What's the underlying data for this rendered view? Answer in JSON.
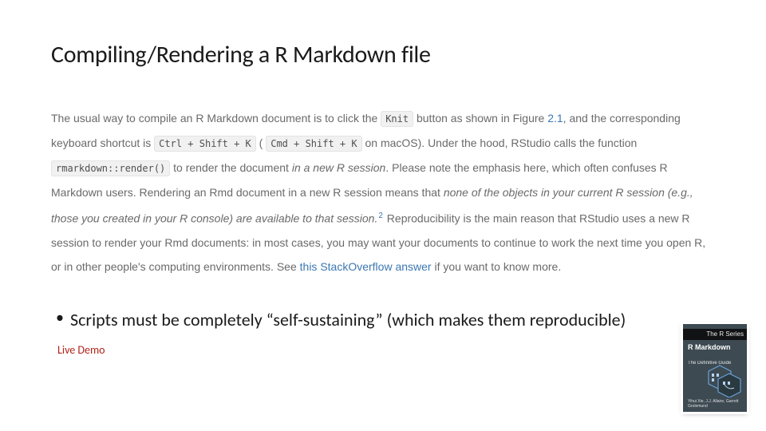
{
  "title": "Compiling/Rendering a R Markdown file",
  "excerpt": {
    "pre_knit": "The usual way to compile an R Markdown document is to click the ",
    "knit_code": "Knit",
    "post_knit": " button as shown in Figure ",
    "fig_ref": "2.1",
    "after_fig": ", and the corresponding keyboard shortcut is ",
    "kbd1": "Ctrl + Shift + K",
    "paren_open": " (",
    "kbd2": "Cmd + Shift + K",
    "paren_close": " on macOS). Under the hood, RStudio calls the function ",
    "render_code": "rmarkdown::render()",
    "after_render": " to render the document ",
    "em1": "in a new R session",
    "after_em1": ". Please note the emphasis here, which often confuses R Markdown users. Rendering an Rmd document in a new R session means that ",
    "em2": "none of the objects in your current R session (e.g., those you created in your R console) are available to that session.",
    "sup": "2",
    "after_sup": " Reproducibility is the main reason that RStudio uses a new R session to render your Rmd documents: in most cases, you may want your documents to continue to work the next time you open R, or in other people's computing environments. See ",
    "so_link": "this StackOverflow answer",
    "tail": " if you want to know more."
  },
  "bullet": "Scripts must be completely “self-sustaining” (which makes them reproducible)",
  "live_demo": "Live Demo",
  "book": {
    "series": "The R Series",
    "title": "R Markdown",
    "subtitle": "The Definitive Guide",
    "authors": "Yihui Xie, J.J. Allaire, Garrett Grolemund"
  }
}
